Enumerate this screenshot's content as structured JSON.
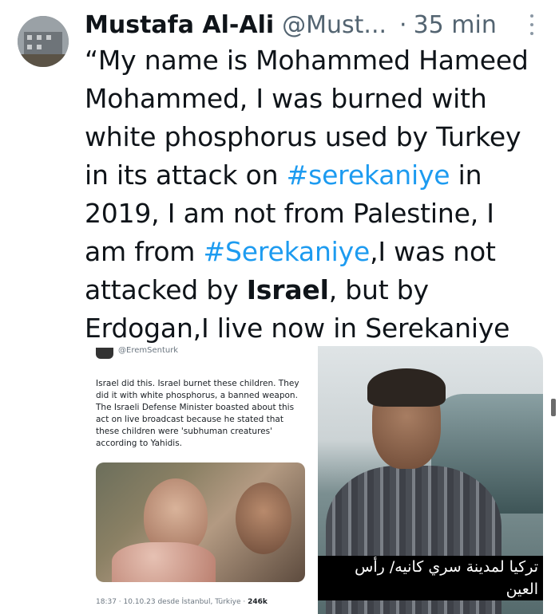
{
  "header": {
    "display_name": "Mustafa Al-Ali",
    "handle": "@Must...",
    "separator": "·",
    "time": "35 min"
  },
  "tweet": {
    "part1": "“My name is Mohammed Hameed Mohammed, I was burned with white phosphorus used by Turkey in its attack on ",
    "hashtag1": "#serekaniye",
    "part2": " in 2019, I am not from Palestine, I am from ",
    "hashtag2": "#Serekaniye",
    "part3": ",I was not attacked by ",
    "bold_word": "Israel",
    "part4": ", but by Erdogan,I live now in Serekaniye camp”"
  },
  "media_left": {
    "handle": "@EremSenturk",
    "text": "Israel did this. Israel burnet these children. They did it with white phosphorus, a banned weapon. The Israeli Defense Minister boasted about this act on live broadcast because he stated that these children were 'subhuman creatures' according to Yahidis.",
    "meta_prefix": "18:37 · 10.10.23 desde İstanbul, Türkiye · ",
    "views": "246k"
  },
  "media_right": {
    "caption": "تركيا لمدينة سري كانيه/ رأس العين"
  },
  "icons": {
    "more": "more-vertical-icon"
  }
}
